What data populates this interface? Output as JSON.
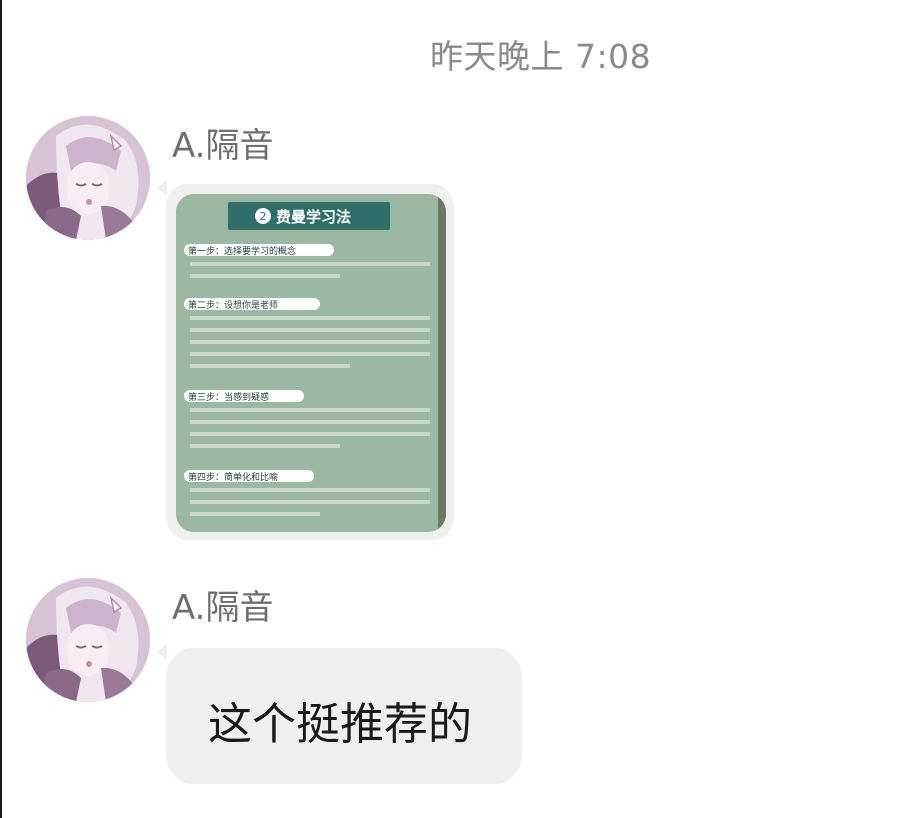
{
  "chat": {
    "timestamp": "昨天晚上 7:08",
    "messages": [
      {
        "sender": "A.隔音",
        "type": "image",
        "image": {
          "title": "费曼学习法",
          "sections": [
            {
              "heading": "第一步：选择要学习的概念"
            },
            {
              "heading": "第二步：设想你是老师"
            },
            {
              "heading": "第三步：当感到疑惑"
            },
            {
              "heading": "第四步：简单化和比喻"
            }
          ]
        }
      },
      {
        "sender": "A.隔音",
        "type": "text",
        "text": "这个挺推荐的"
      }
    ]
  },
  "colors": {
    "bubble": "#efefed",
    "card_bg": "#9bb9a2",
    "card_title": "#2f6f6a",
    "timestamp": "#8a8a8a",
    "sender": "#6e6e6e"
  },
  "icons": {
    "avatar": "anime-girl-avatar"
  }
}
